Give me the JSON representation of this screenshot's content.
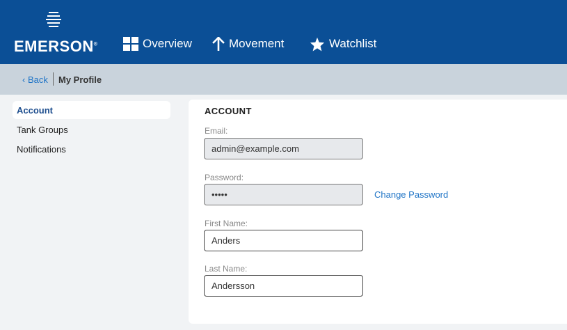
{
  "header": {
    "brand": "EMERSON",
    "brand_mark": "®",
    "nav": [
      {
        "label": "Overview",
        "icon": "grid-icon"
      },
      {
        "label": "Movement",
        "icon": "arrow-up-icon"
      },
      {
        "label": "Watchlist",
        "icon": "star-icon"
      }
    ]
  },
  "breadcrumb": {
    "back": "‹ Back",
    "current": "My Profile"
  },
  "sidebar": {
    "items": [
      "Account",
      "Tank Groups",
      "Notifications"
    ],
    "active": "Account"
  },
  "account": {
    "title": "ACCOUNT",
    "email_label": "Email:",
    "email": "admin@example.com",
    "password_label": "Password:",
    "password": "•••••",
    "change_password": "Change Password",
    "first_name_label": "First Name:",
    "first_name": "Anders",
    "last_name_label": "Last Name:",
    "last_name": "Andersson"
  },
  "colors": {
    "header": "#0b4f96",
    "subbar": "#c9d3dc",
    "link": "#1f74c6"
  }
}
